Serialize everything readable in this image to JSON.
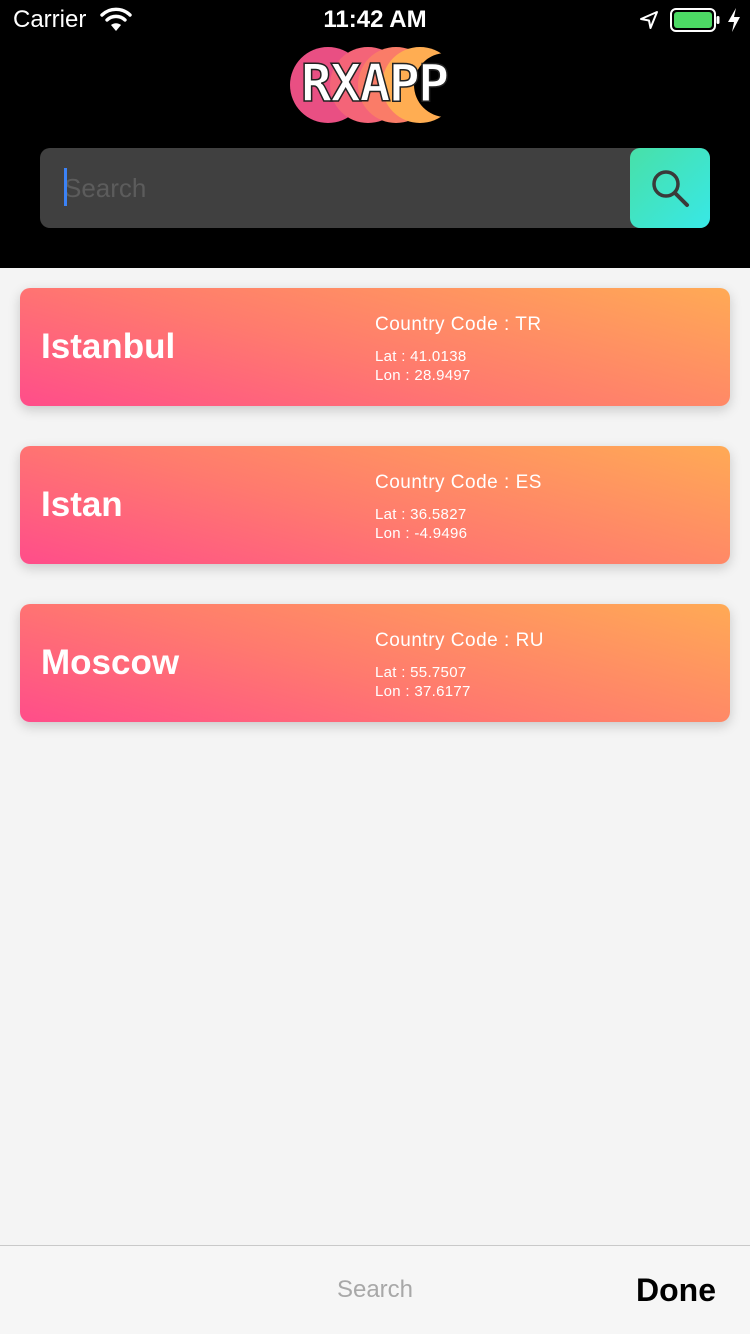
{
  "status_bar": {
    "carrier": "Carrier",
    "time": "11:42 AM",
    "battery_color": "#4cd964"
  },
  "header": {
    "logo_text": "RXAPP",
    "logo_colors": [
      "#ec4f82",
      "#f6707a",
      "#fb8a60",
      "#ffad52"
    ],
    "background": "#000000"
  },
  "search": {
    "placeholder": "Search",
    "value": "",
    "button_icon": "search-icon",
    "button_color": "#3ee6d0"
  },
  "cities": [
    {
      "name": "Istanbul",
      "country_code": "Country Code : TR",
      "lat": "Lat : 41.0138",
      "lon": "Lon : 28.9497"
    },
    {
      "name": "Istan",
      "country_code": "Country Code : ES",
      "lat": "Lat : 36.5827",
      "lon": "Lon : -4.9496"
    },
    {
      "name": "Moscow",
      "country_code": "Country Code : RU",
      "lat": "Lat : 55.7507",
      "lon": "Lon : 37.6177"
    }
  ],
  "keyboard_toolbar": {
    "search_label": "Search",
    "done_label": "Done"
  }
}
